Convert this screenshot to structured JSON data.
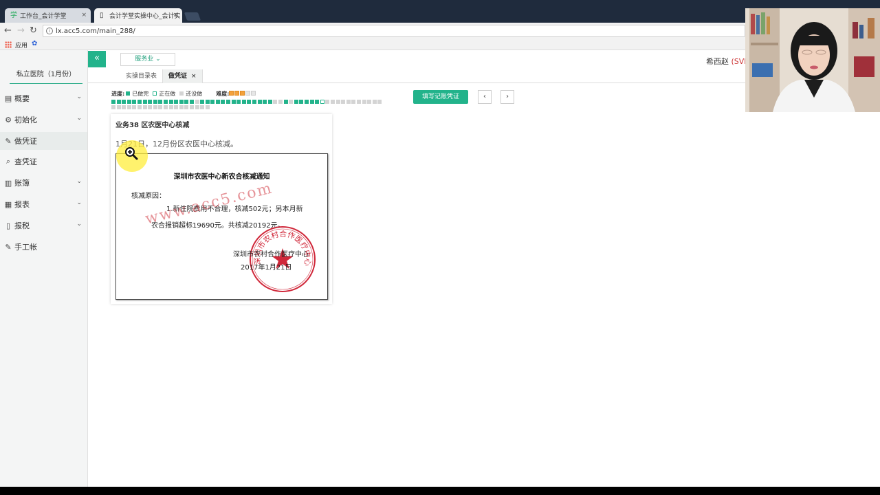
{
  "browser": {
    "tabs": [
      {
        "title": "工作台_会计学堂"
      },
      {
        "title": "会计学堂实操中心_会计实"
      }
    ],
    "close_glyph": "×",
    "url": "lx.acc5.com/main_288/",
    "bookmarks": {
      "apps_label": "应用"
    }
  },
  "header": {
    "industry": "服务业",
    "username": "希西赵",
    "user_vip": "(SVI"
  },
  "sidebar": {
    "company": "私立医院（1月份）",
    "items": [
      {
        "label": "概要",
        "icon": "overview-icon",
        "expandable": true
      },
      {
        "label": "初始化",
        "icon": "gear-icon",
        "expandable": true
      },
      {
        "label": "做凭证",
        "icon": "pen-icon",
        "expandable": false,
        "active": true
      },
      {
        "label": "查凭证",
        "icon": "search-icon",
        "expandable": false
      },
      {
        "label": "账簿",
        "icon": "book-icon",
        "expandable": true
      },
      {
        "label": "报表",
        "icon": "report-icon",
        "expandable": true
      },
      {
        "label": "报税",
        "icon": "tax-icon",
        "expandable": true
      },
      {
        "label": "手工帐",
        "icon": "pen-icon",
        "expandable": false
      }
    ]
  },
  "subtabs": [
    {
      "label": "实操目录表"
    },
    {
      "label": "做凭证",
      "closable": true
    }
  ],
  "progress": {
    "label": "进度:",
    "legend": [
      {
        "label": "已做完",
        "color": "#22b38b"
      },
      {
        "label": "正在做",
        "color": "#ffffff"
      },
      {
        "label": "还没做",
        "color": "#d4d4d4"
      }
    ],
    "difficulty_label": "难度:",
    "difficulty_stars": 3,
    "difficulty_max": 5,
    "cells": "ddddddddddddddddnddddddddddddddnndndddddcnnnnnnnnnnnnnnnnnnnnnnnnnnnnnn"
  },
  "actions": {
    "fill_voucher": "填写记账凭证",
    "prev": "‹",
    "next": "›"
  },
  "task": {
    "title": "业务38 区农医中心核减",
    "description": "1月21日，12月份区农医中心核减。"
  },
  "notice": {
    "title": "深圳市农医中心新农合核减通知",
    "reason_label": "核减原因：",
    "line1": "1.新住院费用不合理，核减502元；另本月新",
    "line2": "农合报销超标19690元。共核减20192元。",
    "org": "深圳市农村合作医疗中心",
    "date": "2017年1月21日",
    "watermark": "www.acc5.com",
    "seal_text": "深圳市农村合作医疗中心"
  },
  "colors": {
    "accent": "#22b38b",
    "seal": "#d0283a",
    "done": "#22b38b",
    "todo": "#d4d4d4"
  }
}
